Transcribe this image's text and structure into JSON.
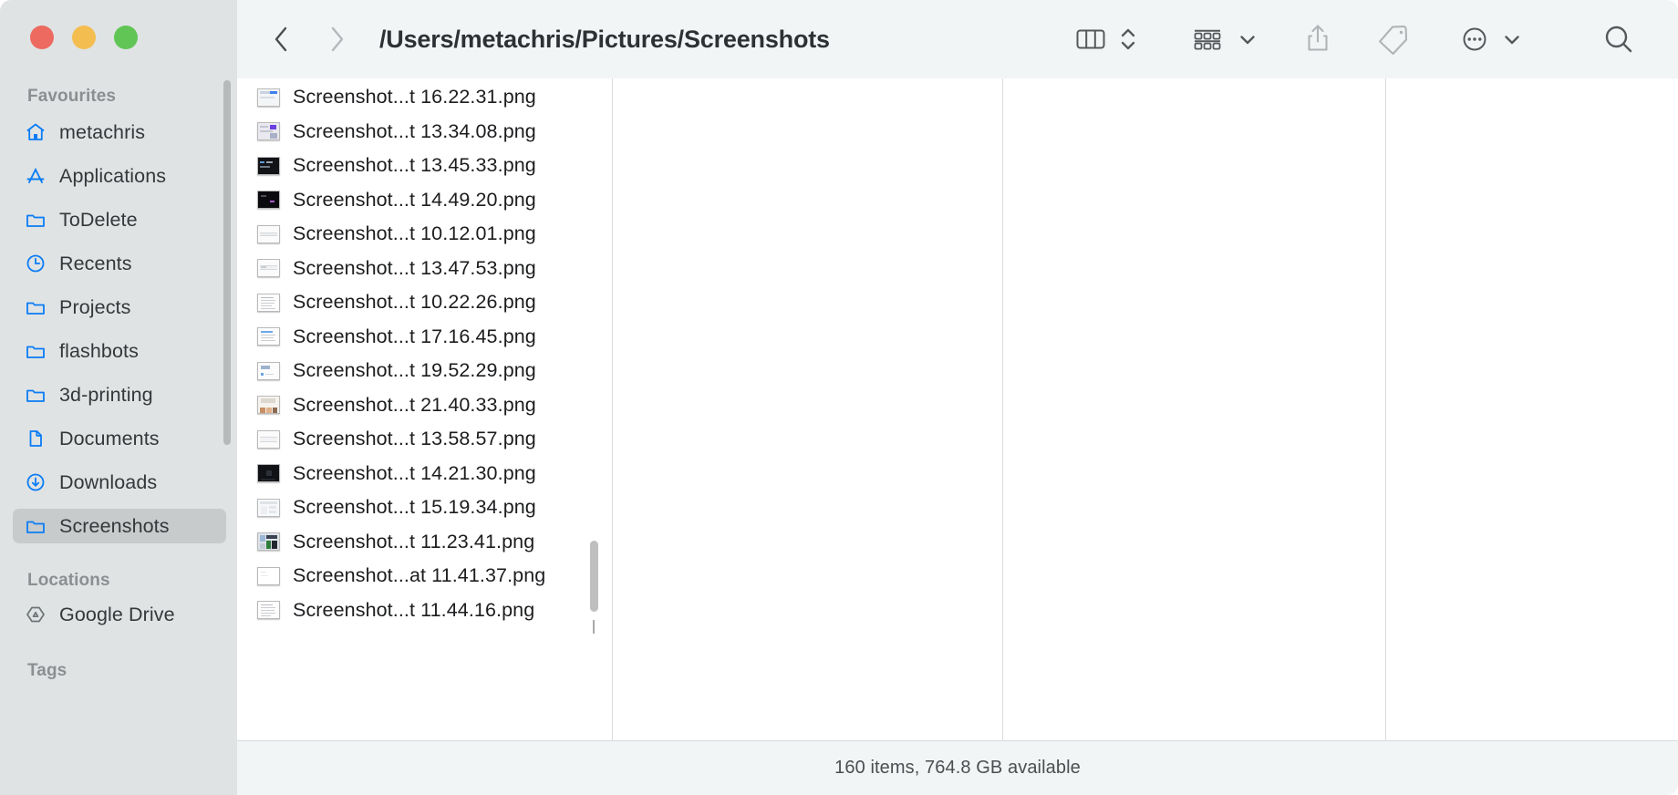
{
  "window": {
    "traffic_lights": [
      {
        "name": "close",
        "color": "#ec6a5f"
      },
      {
        "name": "minimize",
        "color": "#f4bd4f"
      },
      {
        "name": "zoom",
        "color": "#61c555"
      }
    ]
  },
  "toolbar": {
    "back_icon": "chevron-left-icon",
    "forward_icon": "chevron-right-icon",
    "path_title": "/Users/metachris/Pictures/Screenshots",
    "view_icon": "column-view-icon",
    "view_stepper_icon": "chevron-up-down-icon",
    "group_icon": "group-items-icon",
    "group_chevron_icon": "chevron-down-icon",
    "share_icon": "share-icon",
    "tag_icon": "tag-icon",
    "more_icon": "ellipsis-circle-icon",
    "more_chevron_icon": "chevron-down-icon",
    "search_icon": "search-icon"
  },
  "sidebar": {
    "sections": [
      {
        "label": "Favourites"
      },
      {
        "label": "Locations"
      },
      {
        "label": "Tags"
      }
    ],
    "favourites": [
      {
        "label": "metachris",
        "icon": "home-icon",
        "selected": false
      },
      {
        "label": "Applications",
        "icon": "appstore-icon",
        "selected": false
      },
      {
        "label": "ToDelete",
        "icon": "folder-icon",
        "selected": false
      },
      {
        "label": "Recents",
        "icon": "clock-icon",
        "selected": false
      },
      {
        "label": "Projects",
        "icon": "folder-icon",
        "selected": false
      },
      {
        "label": "flashbots",
        "icon": "folder-icon",
        "selected": false
      },
      {
        "label": "3d-printing",
        "icon": "folder-icon",
        "selected": false
      },
      {
        "label": "Documents",
        "icon": "document-icon",
        "selected": false
      },
      {
        "label": "Downloads",
        "icon": "download-icon",
        "selected": false
      },
      {
        "label": "Screenshots",
        "icon": "folder-icon",
        "selected": true
      }
    ],
    "locations": [
      {
        "label": "Google Drive",
        "icon": "google-drive-icon",
        "selected": false
      }
    ]
  },
  "files": [
    {
      "name": "Screenshot...t 16.22.31.png",
      "thumb": "light-window"
    },
    {
      "name": "Screenshot...t 13.34.08.png",
      "thumb": "light-purple"
    },
    {
      "name": "Screenshot...t 13.45.33.png",
      "thumb": "dark-terminal"
    },
    {
      "name": "Screenshot...t 14.49.20.png",
      "thumb": "dark-solid"
    },
    {
      "name": "Screenshot...t 10.12.01.png",
      "thumb": "thin-bar"
    },
    {
      "name": "Screenshot...t 13.47.53.png",
      "thumb": "thin-bar"
    },
    {
      "name": "Screenshot...t 10.22.26.png",
      "thumb": "text-doc"
    },
    {
      "name": "Screenshot...t 17.16.45.png",
      "thumb": "text-doc-blue"
    },
    {
      "name": "Screenshot...t 19.52.29.png",
      "thumb": "light-form"
    },
    {
      "name": "Screenshot...t 21.40.33.png",
      "thumb": "photo-strip"
    },
    {
      "name": "Screenshot...t 13.58.57.png",
      "thumb": "thin-bar"
    },
    {
      "name": "Screenshot...t 14.21.30.png",
      "thumb": "dark-terminal"
    },
    {
      "name": "Screenshot...t 15.19.34.png",
      "thumb": "light-window"
    },
    {
      "name": "Screenshot...t 11.23.41.png",
      "thumb": "colorful-window"
    },
    {
      "name": "Screenshot...at 11.41.37.png",
      "thumb": "blank-page"
    },
    {
      "name": "Screenshot...t 11.44.16.png",
      "thumb": "text-doc"
    }
  ],
  "status": {
    "text": "160 items, 764.8 GB available"
  }
}
